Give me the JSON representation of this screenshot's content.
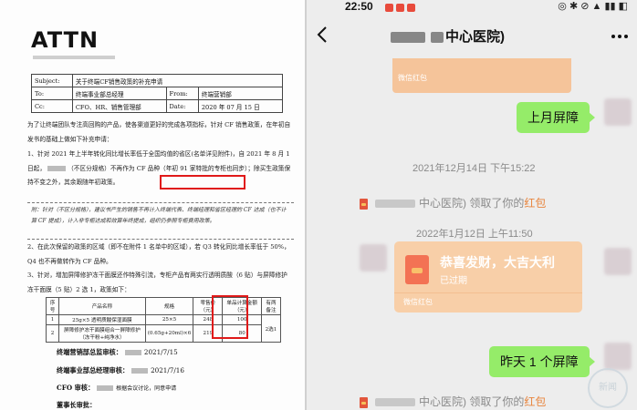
{
  "document": {
    "header": {
      "subject_label": "Subject:",
      "subject_value": "关于终端CF销售政策的补充申请",
      "to_label": "To:",
      "to_value": "终端事业部总经理",
      "from_label": "From:",
      "from_value": "终端营销部",
      "cc_label": "Cc:",
      "cc_value": "CFO、HR、销售管理部",
      "date_label": "Date:",
      "date_value": "2020 年 07 月 15 日"
    },
    "intro": "为了让终端团队专注高回购的产品，使各渠道更好的完成各项指标，针对 CF 销售政策，在年初自发书的基础上做如下补充申请：",
    "item1": "1、针对 2021 年上半年转化同比增长率低于全国均值的省区(名单详见附件)，自 2021 年 8 月 1 日起，",
    "item1_tag": "（不区分规格）不再作为 CF 品种（年初 91 家特批的专柜也同步）；",
    "item1_highlight": "除买生政策保持不变之外",
    "item1_end": "，其余跟随年初政策。",
    "note1": "附：针对（不区分规格），建议书产生的销售不再计入终端代表、终端经理和省区经理的 CF 达成（也不计算 CF 提成），计入非专柜达成和效算年终提成，组织仍参照专柜费用政策。",
    "item2": "2、在此次保留的政策的区域（即不在附件 1 名单中的区域），若 Q3 转化同比增长率低于 50%，Q4 也不再做转作为 CF 品种。",
    "item3": "3、针对，增加屏障修护冻干面膜还作特殊引流，专柜产品有两实行透明质酸（6 贴）与屏障修护冻干面膜（5 贴）2 选 1，政策如下：",
    "table": {
      "headers": [
        "序号",
        "产品名称",
        "规格",
        "零售价（元）",
        "单品计算金额（元）",
        "有两备注"
      ],
      "rows": [
        [
          "1",
          "25g×5 透明质酸保湿面膜",
          "25×5",
          "248",
          "100",
          "2选1"
        ],
        [
          "2",
          "屏障修护冻干面膜组合一屏障修护（冻干粉+纯净水）",
          "(0.65g+20ml)×6",
          "219",
          "80",
          ""
        ]
      ]
    },
    "sign1_label": "终端营销部总监审核：",
    "sign1_date": "2021/7/15",
    "sign2_label": "终端事业部总经理审核：",
    "sign2_date": "2021/7/16",
    "sign3_label": "CFO 审核：",
    "sign3_note": "根据会议讨论，同意申请",
    "sign4_label": "董事长审批："
  },
  "chat": {
    "status_time": "22:50",
    "title": "中心医院)",
    "top_redpacket_label": "微信红包",
    "bubble1": "上月屏障",
    "time1": "2021年12月14日 下午15:22",
    "sys1_text": "中心医院)  领取了你的",
    "sys1_red": "红包",
    "time2": "2022年1月12日 上午11:50",
    "card_msg": "恭喜发财，大吉大利",
    "card_status": "已过期",
    "card_foot": "微信红包",
    "bubble2": "昨天 1 个屏障",
    "sys2_text": "中心医院)  领取了你的",
    "sys2_red": "红包",
    "watermark": "新闻"
  },
  "colors": {
    "wechat_green": "#95ec69",
    "redpacket_orange": "#f8cfa8",
    "highlight_red": "#e01919"
  }
}
